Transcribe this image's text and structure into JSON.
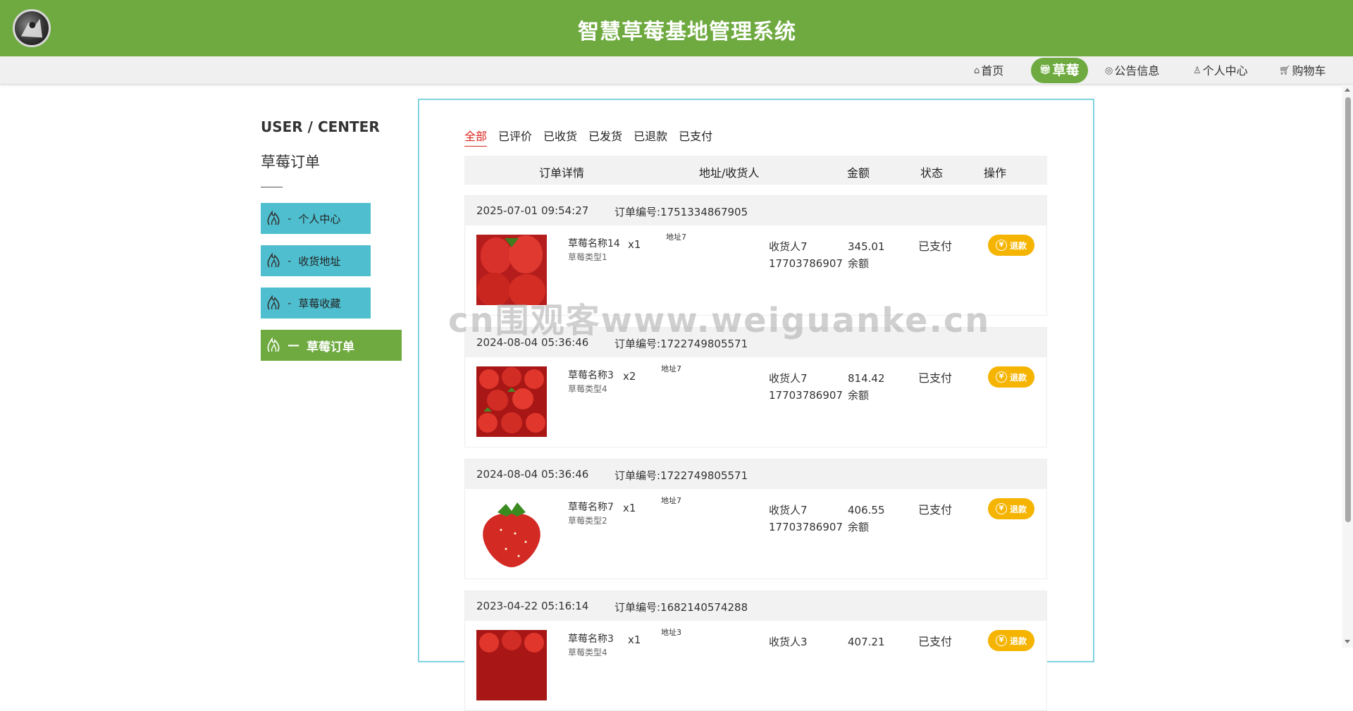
{
  "header": {
    "title": "智慧草莓基地管理系统"
  },
  "nav": [
    {
      "label": "首页",
      "icon": "home-icon"
    },
    {
      "label": "草莓",
      "icon": "gift-icon"
    },
    {
      "label": "公告信息",
      "icon": "palette-icon"
    },
    {
      "label": "个人中心",
      "icon": "user-icon"
    },
    {
      "label": "购物车",
      "icon": "cart-icon"
    }
  ],
  "sidebar": {
    "title": "USER / CENTER",
    "subtitle": "草莓订单",
    "items": [
      {
        "label": "个人中心",
        "dash": "-"
      },
      {
        "label": "收货地址",
        "dash": "-"
      },
      {
        "label": "草莓收藏",
        "dash": "-"
      },
      {
        "label": "草莓订单",
        "dash": "—"
      }
    ]
  },
  "tabs": [
    "全部",
    "已评价",
    "已收货",
    "已发货",
    "已退款",
    "已支付"
  ],
  "table_header": [
    "订单详情",
    "地址/收货人",
    "金额",
    "状态",
    "操作"
  ],
  "orders": [
    {
      "date": "2025-07-01 09:54:27",
      "order_no": "订单编号:1751334867905",
      "name": "草莓名称14",
      "type": "草莓类型1",
      "qty": "x1",
      "addr": "地址7",
      "receiver": "收货人7",
      "phone": "17703786907",
      "amount": "345.01",
      "pay": "余额",
      "status": "已支付",
      "action": "退款"
    },
    {
      "date": "2024-08-04 05:36:46",
      "order_no": "订单编号:1722749805571",
      "name": "草莓名称3",
      "type": "草莓类型4",
      "qty": "x2",
      "addr": "地址7",
      "receiver": "收货人7",
      "phone": "17703786907",
      "amount": "814.42",
      "pay": "余额",
      "status": "已支付",
      "action": "退款"
    },
    {
      "date": "2024-08-04 05:36:46",
      "order_no": "订单编号:1722749805571",
      "name": "草莓名称7",
      "type": "草莓类型2",
      "qty": "x1",
      "addr": "地址7",
      "receiver": "收货人7",
      "phone": "17703786907",
      "amount": "406.55",
      "pay": "余额",
      "status": "已支付",
      "action": "退款"
    },
    {
      "date": "2023-04-22 05:16:14",
      "order_no": "订单编号:1682140574288",
      "name": "草莓名称3",
      "type": "草莓类型4",
      "qty": "x1",
      "addr": "地址3",
      "receiver": "收货人3",
      "phone": "",
      "amount": "407.21",
      "pay": "",
      "status": "已支付",
      "action": "退款"
    }
  ],
  "watermark": "cn围观客www.weiguanke.cn",
  "colors": {
    "brand": "#6eaa40",
    "sidebar": "#4fbfcf",
    "refund": "#f5b400",
    "active_tab": "#d9251d"
  }
}
